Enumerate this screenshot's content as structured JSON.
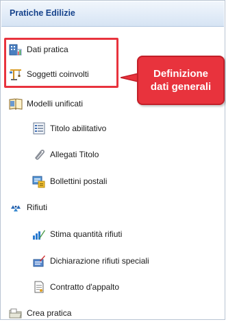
{
  "panel": {
    "title": "Pratiche Edilizie"
  },
  "items": {
    "dati_pratica": "Dati pratica",
    "soggetti_coinvolti": "Soggetti coinvolti",
    "modelli_unificati": "Modelli unificati",
    "titolo_abilitativo": "Titolo abilitativo",
    "allegati_titolo": "Allegati Titolo",
    "bollettini_postali": "Bollettini postali",
    "rifiuti": "Rifiuti",
    "stima_quantita_rifiuti": "Stima quantità rifiuti",
    "dichiarazione_rifiuti_speciali": "Dichiarazione rifiuti speciali",
    "contratto_appalto": "Contratto d'appalto",
    "crea_pratica": "Crea pratica"
  },
  "callout": {
    "line1": "Definizione",
    "line2": "dati generali"
  },
  "colors": {
    "header_text": "#15428b",
    "highlight": "#e8333d"
  }
}
